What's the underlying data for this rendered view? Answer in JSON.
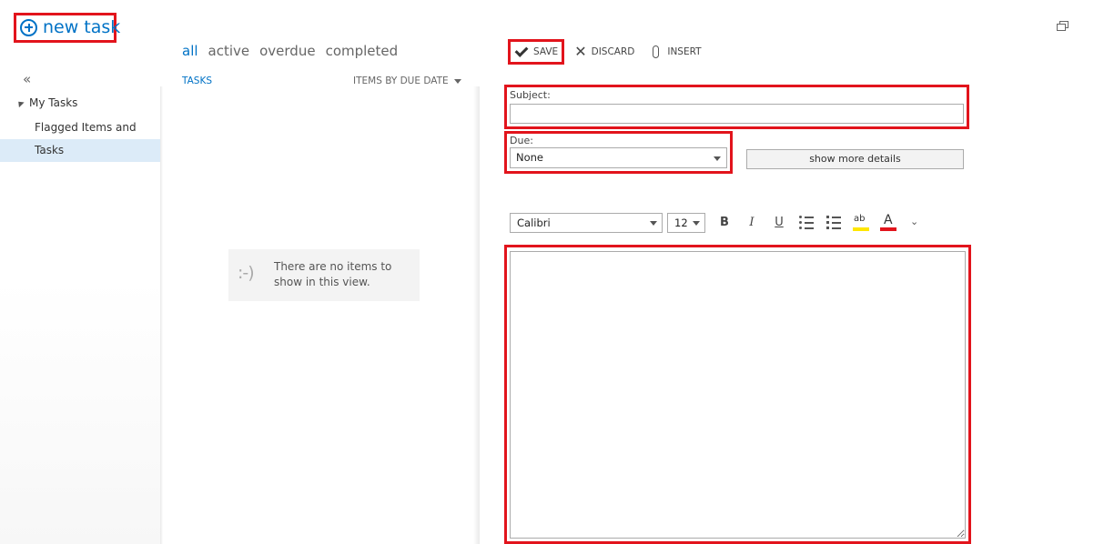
{
  "header": {
    "new_task_label": "new task"
  },
  "nav": {
    "collapse_glyph": "«",
    "group_label": "My Tasks",
    "items": [
      {
        "label": "Flagged Items and Tasks"
      },
      {
        "label": "Tasks",
        "selected": true
      }
    ]
  },
  "list": {
    "filters": [
      "all",
      "active",
      "overdue",
      "completed"
    ],
    "active_filter": "all",
    "section_label": "TASKS",
    "sort_label": "ITEMS BY DUE DATE",
    "empty_face": ":-)",
    "empty_message": "There are no items to show in this view."
  },
  "toolbar": {
    "save_label": "SAVE",
    "discard_label": "DISCARD",
    "insert_label": "INSERT"
  },
  "form": {
    "subject_label": "Subject:",
    "subject_value": "",
    "due_label": "Due:",
    "due_value": "None",
    "more_details_label": "show more details",
    "font_value": "Calibri",
    "size_value": "12",
    "bold_glyph": "B",
    "italic_glyph": "I",
    "underline_glyph": "U",
    "highlight_glyph": "ab",
    "color_glyph": "A",
    "more_glyph": "⌄",
    "body_value": ""
  },
  "colors": {
    "accent": "#0072c6",
    "highlight_box": "#e2141c",
    "selected_nav": "#dcebf8"
  },
  "icons": [
    "plus-circle-icon",
    "popout-icon",
    "checkmark-icon",
    "close-icon",
    "paperclip-icon",
    "bullet-list-icon",
    "numbered-list-icon",
    "highlight-icon",
    "font-color-icon",
    "chevron-down-icon"
  ]
}
